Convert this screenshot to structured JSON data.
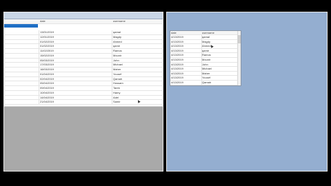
{
  "left_grid": {
    "headers": {
      "col1": "",
      "col2": "date",
      "col3": "username"
    },
    "rows": [
      {
        "date": "13/01/2019",
        "username": "qamal"
      },
      {
        "date": "12/01/2019",
        "username": "Magdy"
      },
      {
        "date": "01/02/2019",
        "username": "Ahmed"
      },
      {
        "date": "01/02/2019",
        "username": "qamir"
      },
      {
        "date": "11/02/2019",
        "username": "Ramos"
      },
      {
        "date": "15/02/2019",
        "username": "Mounir"
      },
      {
        "date": "05/03/2019",
        "username": "John"
      },
      {
        "date": "17/03/2019",
        "username": "Michael"
      },
      {
        "date": "18/03/2019",
        "username": "Maher"
      },
      {
        "date": "01/04/2019",
        "username": "Yousef"
      },
      {
        "date": "02/04/2019",
        "username": "Qamah"
      },
      {
        "date": "05/04/2019",
        "username": "Hossam"
      },
      {
        "date": "09/04/2019",
        "username": "Tarek"
      },
      {
        "date": "10/04/2019",
        "username": "Hamy"
      },
      {
        "date": "14/04/2019",
        "username": "Adel"
      },
      {
        "date": "21/04/2019",
        "username": "Samir"
      }
    ]
  },
  "popup_grid": {
    "headers": {
      "col1": "date",
      "col2": "username"
    },
    "rows": [
      {
        "date": "4/13/2019",
        "username": "qamal"
      },
      {
        "date": "4/13/2019",
        "username": "Magdy"
      },
      {
        "date": "4/13/2019",
        "username": "Ahmed"
      },
      {
        "date": "4/13/2019",
        "username": "qamir"
      },
      {
        "date": "4/13/2019",
        "username": "Ramos"
      },
      {
        "date": "4/13/2019",
        "username": "Mounir"
      },
      {
        "date": "4/13/2019",
        "username": "John"
      },
      {
        "date": "4/13/2019",
        "username": "Michael"
      },
      {
        "date": "4/13/2019",
        "username": "Maher"
      },
      {
        "date": "4/13/2019",
        "username": "Yousef"
      },
      {
        "date": "4/13/2019",
        "username": "Qamah"
      }
    ]
  },
  "colors": {
    "left_background": "#a9a9a9",
    "right_background": "#94aed0",
    "selection": "#1f6fc5"
  }
}
